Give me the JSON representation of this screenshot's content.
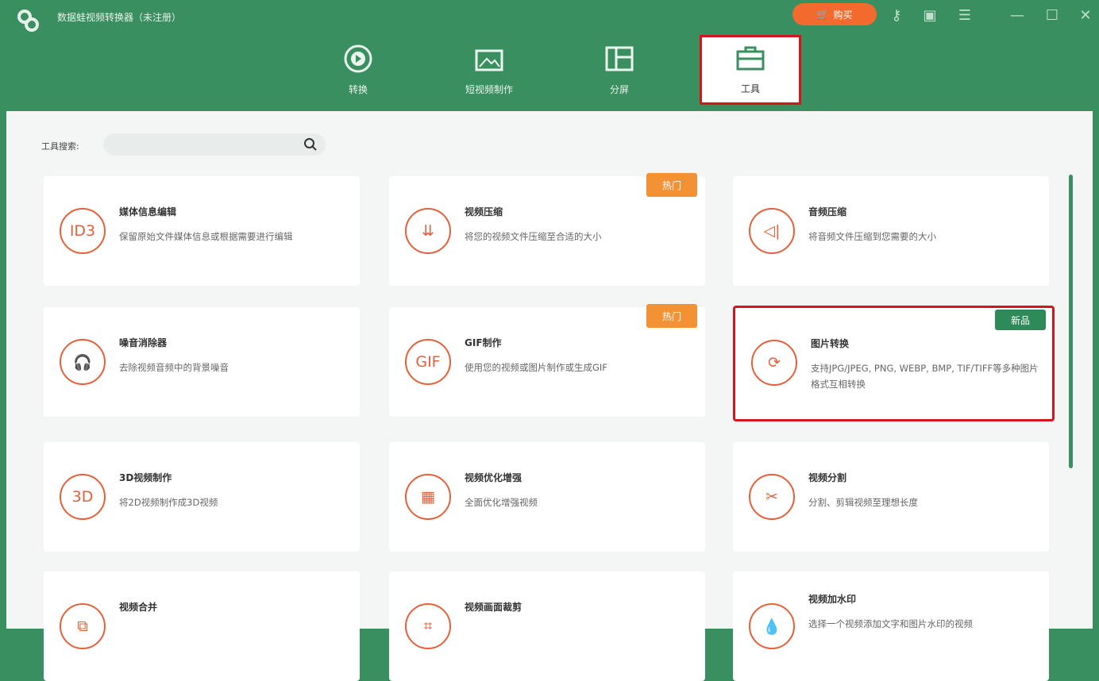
{
  "app": {
    "title": "数据蛙视频转换器（未注册）",
    "buy_label": "购买"
  },
  "tabs": [
    {
      "label": "转换"
    },
    {
      "label": "短视频制作"
    },
    {
      "label": "分屏"
    },
    {
      "label": "工具"
    }
  ],
  "search": {
    "label": "工具搜索:",
    "placeholder": ""
  },
  "tools": [
    {
      "title": "媒体信息编辑",
      "desc": "保留原始文件媒体信息或根据需要进行编辑",
      "icon": "ID3"
    },
    {
      "title": "视频压缩",
      "desc": "将您的视频文件压缩至合适的大小",
      "badge": "热门"
    },
    {
      "title": "音频压缩",
      "desc": "将音频文件压缩到您需要的大小"
    },
    {
      "title": "噪音消除器",
      "desc": "去除视频音频中的背景噪音"
    },
    {
      "title": "GIF制作",
      "desc": "使用您的视频或图片制作或生成GIF",
      "badge": "热门",
      "icon": "GIF"
    },
    {
      "title": "图片转换",
      "desc": "支持JPG/JPEG, PNG, WEBP, BMP, TIF/TIFF等多种图片格式互相转换",
      "badge": "新品"
    },
    {
      "title": "3D视频制作",
      "desc": "将2D视频制作成3D视频",
      "icon": "3D"
    },
    {
      "title": "视频优化增强",
      "desc": "全面优化增强视频"
    },
    {
      "title": "视频分割",
      "desc": "分割、剪辑视频至理想长度"
    },
    {
      "title": "视频合并",
      "desc": ""
    },
    {
      "title": "视频画面裁剪",
      "desc": ""
    },
    {
      "title": "视频加水印",
      "desc": "选择一个视频添加文字和图片水印的视频"
    }
  ],
  "colors": {
    "brand": "#3a8f60",
    "accent": "#e4603a",
    "hot": "#f39234",
    "highlight": "#d8141b"
  }
}
